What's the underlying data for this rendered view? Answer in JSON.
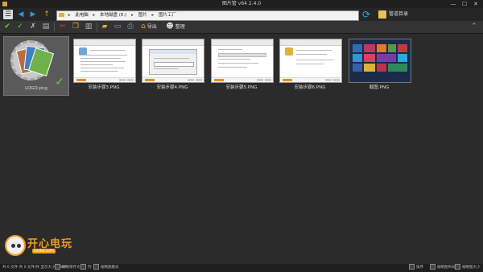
{
  "window": {
    "title": "图片管 v64 2.4.0",
    "min": "—",
    "max": "☐",
    "close": "✕"
  },
  "nav": {
    "back": "◀",
    "forward": "▶",
    "up": "↑",
    "breadcrumb": [
      "此电脑",
      "本地磁盘 (E:)",
      "图片",
      "图片工厂"
    ],
    "sep": "▸",
    "manager_label": "管道目录"
  },
  "toolbar": {
    "labels": {
      "export": "导出",
      "organize": "整理"
    }
  },
  "thumbnails": [
    {
      "name": "LOGO.png"
    },
    {
      "name": "安装步骤3.PNG"
    },
    {
      "name": "安装步骤4.PNG"
    },
    {
      "name": "安装步骤5.PNG"
    },
    {
      "name": "安装步骤6.PNG"
    },
    {
      "name": "截图.PNG"
    }
  ],
  "watermark": {
    "text": "开心电玩",
    "url": "kxdw.com"
  },
  "status": {
    "left": "共 0 文件 共 0 文件/共  显示大小 (SNIM)",
    "opt1": "同时保存文件",
    "opt2": "列",
    "opt3": "缩略图模式",
    "right1": "排序",
    "right2": "缩略图布局",
    "right3": "缩略图大小"
  },
  "colors": {
    "accent": "#f29a1e",
    "check": "#6ecb3a",
    "folder": "#e0b23a"
  }
}
